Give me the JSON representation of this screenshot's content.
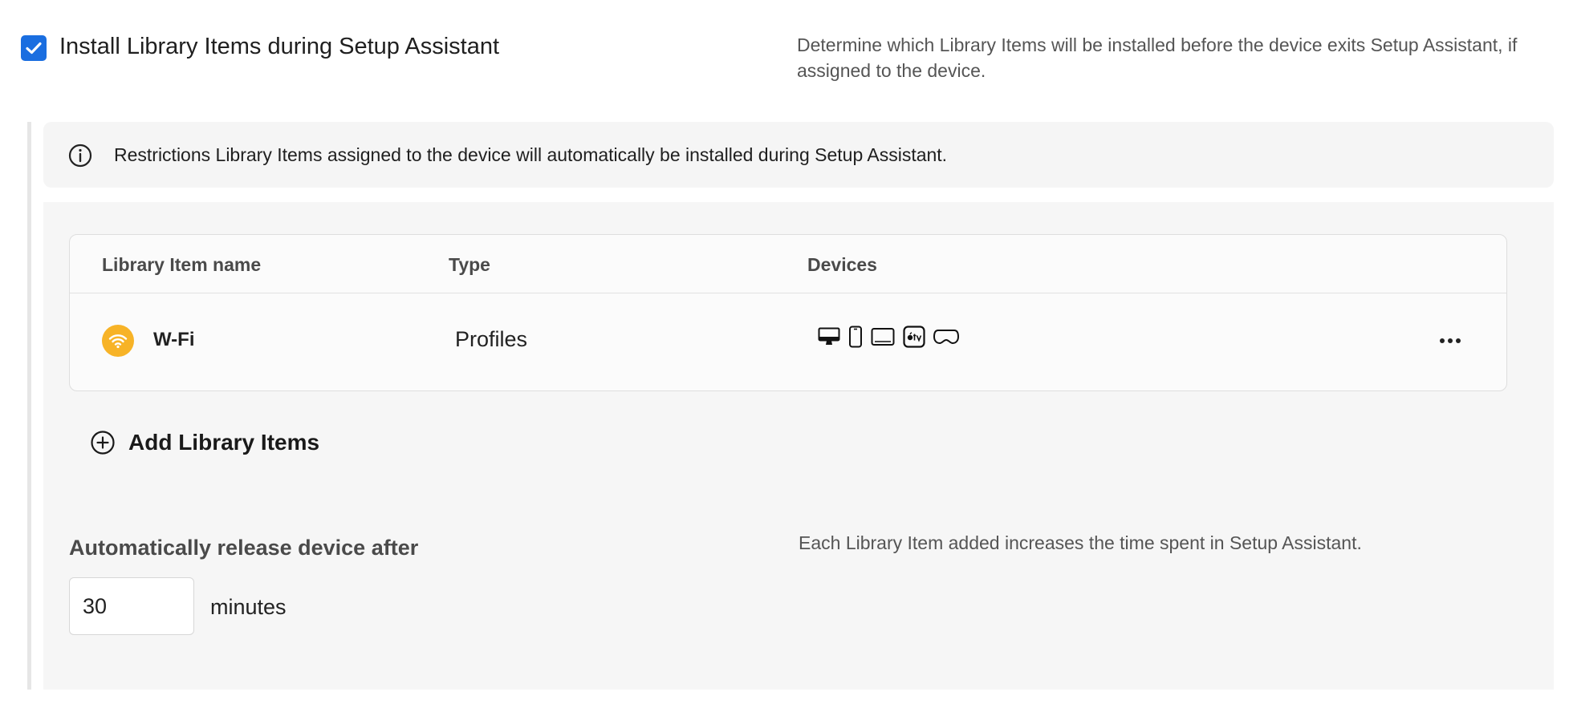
{
  "setup": {
    "checkbox_checked": true,
    "title": "Install Library Items during Setup Assistant",
    "description": "Determine which Library Items will be installed before the device exits Setup Assistant, if assigned to the device."
  },
  "info_banner": {
    "text": "Restrictions Library Items assigned to the device will automatically be installed during Setup Assistant."
  },
  "table": {
    "columns": [
      "Library Item name",
      "Type",
      "Devices"
    ],
    "rows": [
      {
        "name": "W-Fi",
        "type": "Profiles",
        "icon": "wifi-icon",
        "devices": [
          "mac-icon",
          "iphone-icon",
          "ipad-icon",
          "apple-tv-icon",
          "vision-pro-icon"
        ]
      }
    ]
  },
  "add_button": {
    "label": "Add Library Items"
  },
  "auto_release": {
    "label": "Automatically release device after",
    "value": "30",
    "unit": "minutes",
    "description": "Each Library Item added increases the time spent in Setup Assistant."
  },
  "colors": {
    "accent": "#1a6ee0",
    "wifi_badge": "#f7b327"
  }
}
